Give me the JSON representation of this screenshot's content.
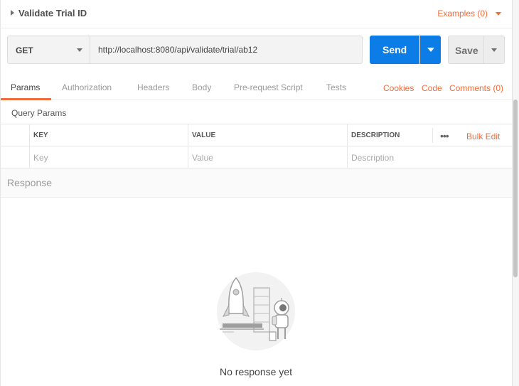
{
  "header": {
    "title": "Validate Trial ID",
    "examples_label": "Examples (0)"
  },
  "request": {
    "method": "GET",
    "url": "http://localhost:8080/api/validate/trial/ab12",
    "send_label": "Send",
    "save_label": "Save"
  },
  "tabs": {
    "items": [
      "Params",
      "Authorization",
      "Headers",
      "Body",
      "Pre-request Script",
      "Tests"
    ],
    "active": "Params",
    "right_links": [
      "Cookies",
      "Code",
      "Comments (0)"
    ]
  },
  "params": {
    "title": "Query Params",
    "columns": [
      "KEY",
      "VALUE",
      "DESCRIPTION"
    ],
    "bulk_edit_label": "Bulk Edit",
    "placeholders": {
      "key": "Key",
      "value": "Value",
      "description": "Description"
    }
  },
  "response": {
    "label": "Response",
    "empty_text": "No response yet"
  },
  "colors": {
    "accent": "#f26b3a",
    "send_button": "#0c7ce6"
  },
  "icons": [
    "caret-right-icon",
    "chevron-down-icon",
    "more-dots-icon",
    "rocket-astronaut-illustration"
  ]
}
